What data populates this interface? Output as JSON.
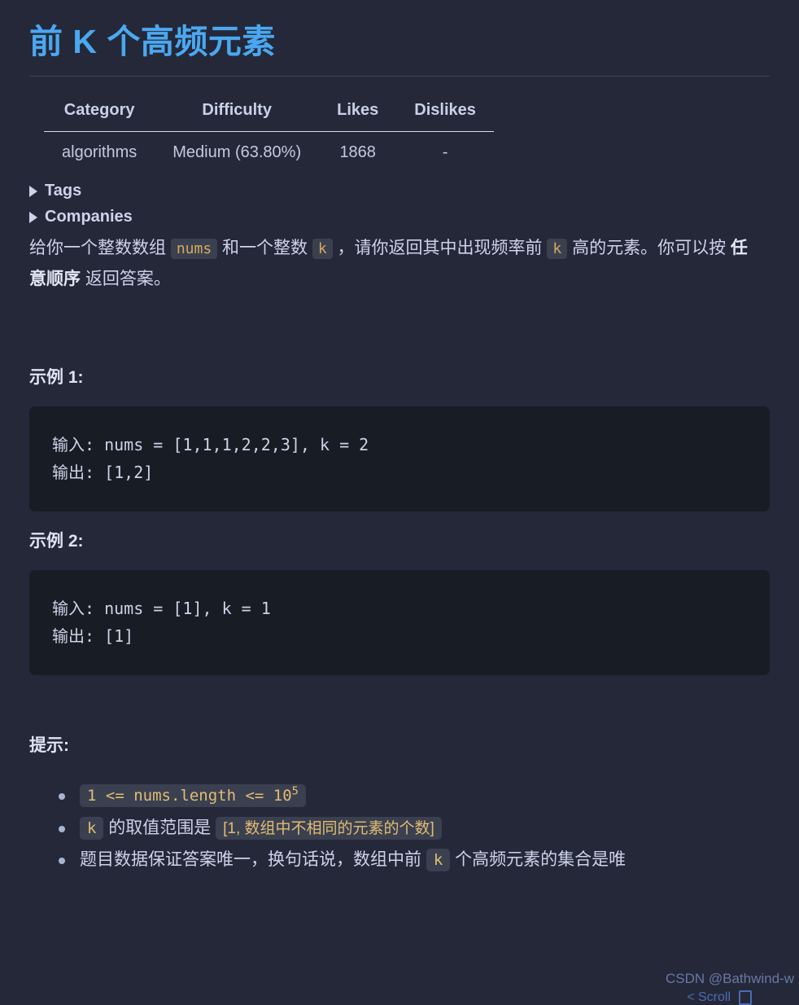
{
  "title": "前 K 个高频元素",
  "table": {
    "headers": [
      "Category",
      "Difficulty",
      "Likes",
      "Dislikes"
    ],
    "rows": [
      [
        "algorithms",
        "Medium (63.80%)",
        "1868",
        "-"
      ]
    ]
  },
  "collapsibles": [
    {
      "label": "Tags",
      "marker": "triangle-right-icon"
    },
    {
      "label": "Companies",
      "marker": "triangle-right-icon"
    }
  ],
  "description": {
    "part1": "给你一个整数数组 ",
    "code1": "nums",
    "part2": " 和一个整数 ",
    "code2": "k",
    "part3": " ，请你返回其中出现频率前 ",
    "code3": "k",
    "part4": " 高的元素。你可以按 ",
    "bold": "任意顺序",
    "part5": " 返回答案。"
  },
  "examples": [
    {
      "heading": "示例 1:",
      "code": "输入: nums = [1,1,1,2,2,3], k = 2\n输出: [1,2]"
    },
    {
      "heading": "示例 2:",
      "code": "输入: nums = [1], k = 1\n输出: [1]"
    }
  ],
  "hints": {
    "heading": "提示:",
    "items": [
      {
        "kind": "code-only",
        "code_prefix": "1 <= nums.length <= 10",
        "code_sup": "5"
      },
      {
        "kind": "mixed",
        "code1": "k",
        "text1": " 的取值范围是 ",
        "code2": "[1, 数组中不相同的元素的个数]"
      },
      {
        "kind": "mixed2",
        "text1": "题目数据保证答案唯一，换句话说，数组中前 ",
        "code1": "k",
        "text2": " 个高频元素的集合是唯"
      }
    ]
  },
  "watermark": "CSDN @Bathwind-w",
  "footer_stub": "< Scroll",
  "colors": {
    "page_background": "#252839",
    "title": "#4aa8f0",
    "text": "#ccd3ea",
    "code_block_background": "#181c25",
    "inline_code_background": "#3b4050",
    "inline_code_text": "#d7a85c",
    "rule": "#414559"
  }
}
